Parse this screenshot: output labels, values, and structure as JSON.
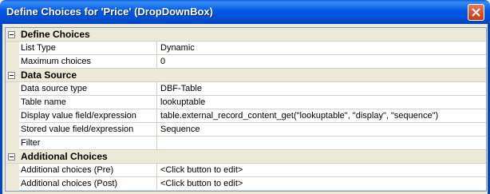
{
  "window": {
    "title": "Define Choices for 'Price' (DropDownBox)"
  },
  "grid": {
    "categories": [
      {
        "label": "Define Choices",
        "properties": [
          {
            "name": "List Type",
            "value": "Dynamic"
          },
          {
            "name": "Maximum choices",
            "value": "0"
          }
        ]
      },
      {
        "label": "Data Source",
        "properties": [
          {
            "name": "Data source type",
            "value": "DBF-Table"
          },
          {
            "name": "Table name",
            "value": "lookuptable"
          },
          {
            "name": "Display value field/expression",
            "value": "table.external_record_content_get(\"lookuptable\", \"display\", \"sequence\")"
          },
          {
            "name": "Stored value field/expression",
            "value": "Sequence"
          },
          {
            "name": "Filter",
            "value": ""
          }
        ]
      },
      {
        "label": "Additional Choices",
        "properties": [
          {
            "name": "Additional choices (Pre)",
            "value": "<Click button to edit>"
          },
          {
            "name": "Additional choices (Post)",
            "value": "<Click button to edit>"
          }
        ]
      }
    ]
  }
}
